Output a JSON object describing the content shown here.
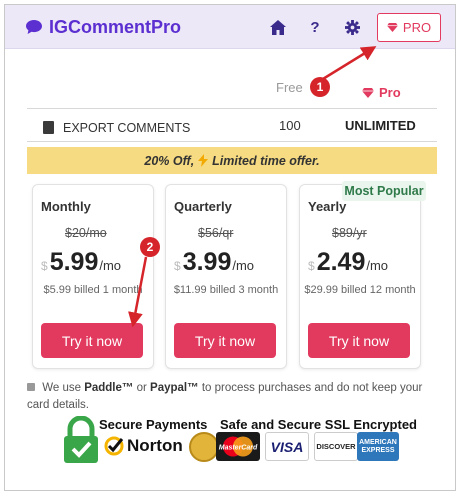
{
  "header": {
    "title": "IGCommentPro",
    "pro_label": "PRO",
    "help_label": "?"
  },
  "comparison": {
    "free_label": "Free",
    "pro_label": "Pro",
    "feature": {
      "label": "EXPORT COMMENTS",
      "free_value": "100",
      "pro_value": "UNLIMITED"
    }
  },
  "promo": {
    "text_before": "20% Off,",
    "icon": "lightning-icon",
    "text_after": "Limited time offer."
  },
  "plans": [
    {
      "name": "Monthly",
      "old_price": "$20/mo",
      "currency": "$",
      "price": "5.99",
      "per": "/mo",
      "billed": "$5.99 billed 1 month",
      "button": "Try it now"
    },
    {
      "name": "Quarterly",
      "old_price": "$56/qr",
      "currency": "$",
      "price": "3.99",
      "per": "/mo",
      "billed": "$11.99 billed 3 month",
      "button": "Try it now"
    },
    {
      "name": "Yearly",
      "old_price": "$89/yr",
      "currency": "$",
      "price": "2.49",
      "per": "/mo",
      "billed": "$29.99 billed 12 month",
      "button": "Try it now"
    }
  ],
  "popular_badge": "Most Popular",
  "note": {
    "prefix": "We use",
    "paddle": "Paddle™",
    "or": "or",
    "paypal": "Paypal™",
    "suffix": "to process purchases and do not keep your card details."
  },
  "badges": {
    "secure_payments": "Secure Payments",
    "norton": "Norton",
    "ssl": "Safe and Secure SSL Encrypted",
    "cards": [
      "MasterCard",
      "VISA",
      "DISCOVER",
      "AMERICAN EXPRESS"
    ]
  },
  "annotations": [
    "1",
    "2"
  ],
  "colors": {
    "accent": "#5c2fd1",
    "brand_red": "#e23a5e",
    "promo_yellow": "#f6db82",
    "popular_green": "#2f7a49"
  }
}
